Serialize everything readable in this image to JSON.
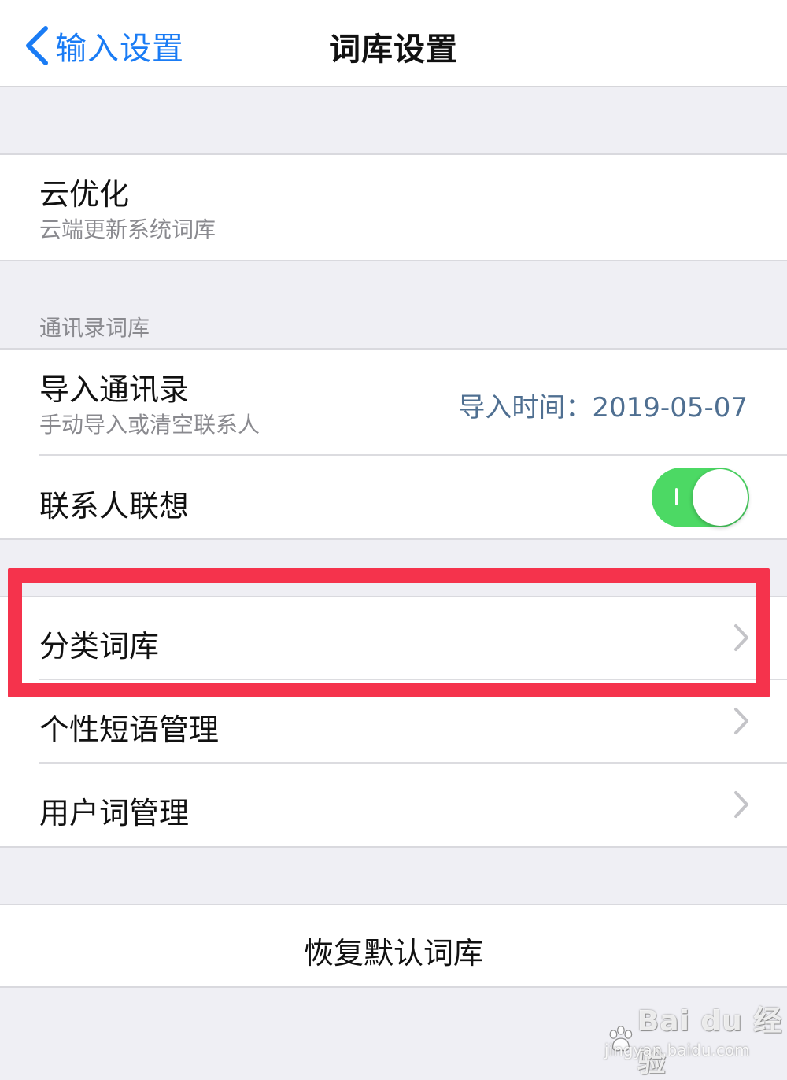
{
  "nav": {
    "back_label": "输入设置",
    "title": "词库设置"
  },
  "cloud": {
    "title": "云优化",
    "subtitle": "云端更新系统词库"
  },
  "contacts_section": {
    "header": "通讯录词库",
    "import": {
      "title": "导入通讯录",
      "subtitle": "手动导入或清空联系人",
      "value": "导入时间：2019-05-07"
    },
    "association": {
      "title": "联系人联想",
      "enabled": true
    }
  },
  "menu": [
    {
      "label": "分类词库"
    },
    {
      "label": "个性短语管理"
    },
    {
      "label": "用户词管理"
    }
  ],
  "reset": {
    "label": "恢复默认词库"
  },
  "watermark": {
    "logo": "Bai du 经验",
    "url": "jingyan.baidu.com"
  },
  "colors": {
    "accent": "#1a7cf5",
    "switch_on": "#4cd964",
    "highlight": "#f5334c",
    "value_text": "#4f6f91"
  }
}
